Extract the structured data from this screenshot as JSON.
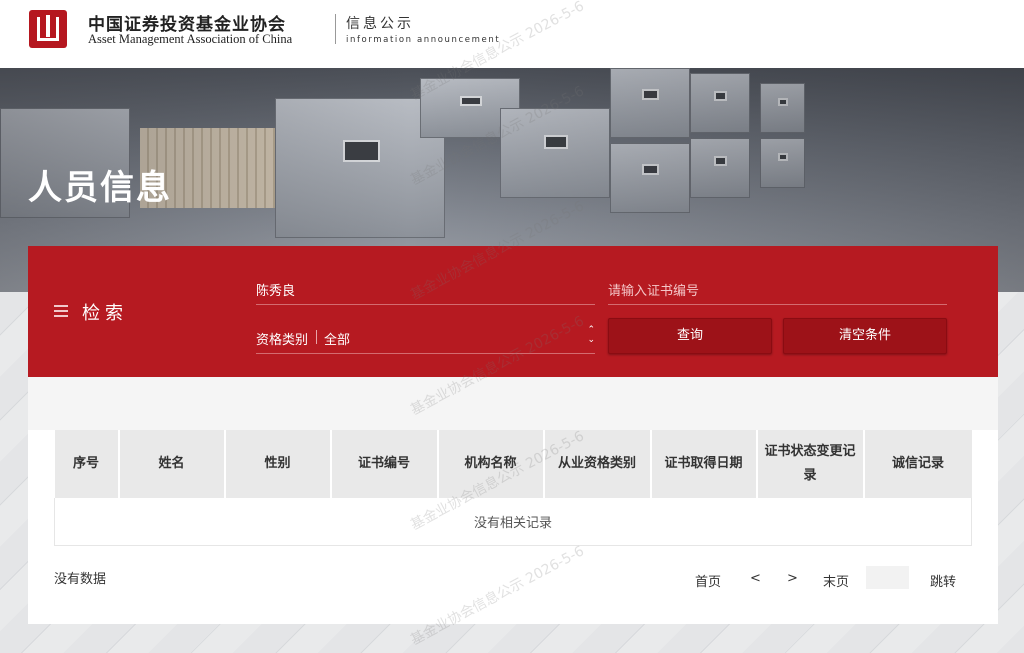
{
  "header": {
    "org_name_cn": "中国证券投资基金业协会",
    "org_name_en": "Asset Management Association of China",
    "section_cn": "信息公示",
    "section_en": "information announcement"
  },
  "banner": {
    "title": "人员信息"
  },
  "search": {
    "label": "检索",
    "name_value": "陈秀良",
    "cert_placeholder": "请输入证书编号",
    "qualification_label": "资格类别",
    "qualification_value": "全部",
    "query_button": "查询",
    "clear_button": "清空条件"
  },
  "table": {
    "columns": [
      "序号",
      "姓名",
      "性别",
      "证书编号",
      "机构名称",
      "从业资格类别",
      "证书取得日期",
      "证书状态变更记录",
      "诚信记录"
    ],
    "empty_text": "没有相关记录"
  },
  "footer": {
    "no_data": "没有数据",
    "first": "首页",
    "prev": "<",
    "next": ">",
    "last": "末页",
    "jump": "跳转"
  },
  "watermark": "基金业协会信息公示 2026-5-6",
  "colors": {
    "brand_red": "#b61a21",
    "button_red": "#9d1218"
  }
}
